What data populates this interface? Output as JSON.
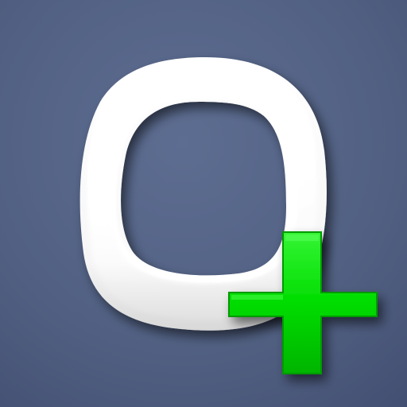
{
  "icon": {
    "name": "app-icon",
    "glyph": "ring-with-plus",
    "colors": {
      "background_top": "#5a6a8e",
      "background_bottom": "#46547a",
      "ring": "#ffffff",
      "ring_shade": "#c9c9c9",
      "plus": "#00e400",
      "plus_light": "#3dff3d",
      "plus_dark": "#00a800"
    }
  }
}
